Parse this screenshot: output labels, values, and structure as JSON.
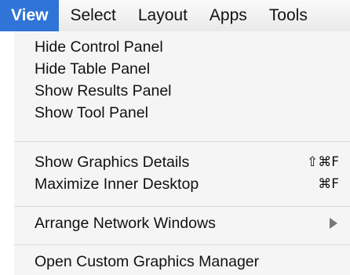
{
  "menubar": {
    "items": [
      "View",
      "Select",
      "Layout",
      "Apps",
      "Tools"
    ],
    "active": "View"
  },
  "menu": {
    "items": [
      {
        "label": "Hide Control Panel",
        "shortcut": ""
      },
      {
        "label": "Hide Table Panel",
        "shortcut": ""
      },
      {
        "label": "Show Results Panel",
        "shortcut": ""
      },
      {
        "label": "Show Tool Panel",
        "shortcut": ""
      },
      {
        "label": "Show Graphics Details",
        "shortcut": "⇧⌘F"
      },
      {
        "label": "Maximize Inner Desktop",
        "shortcut": "⌘F"
      },
      {
        "label": "Arrange Network Windows",
        "shortcut": "",
        "submenu_icon": "chevron-right-icon"
      },
      {
        "label": "Open Custom Graphics Manager",
        "shortcut": ""
      }
    ]
  },
  "colors": {
    "active_highlight": "#2f74d6",
    "menu_background": "#f5f5f5",
    "separator": "#d9d9d9"
  }
}
